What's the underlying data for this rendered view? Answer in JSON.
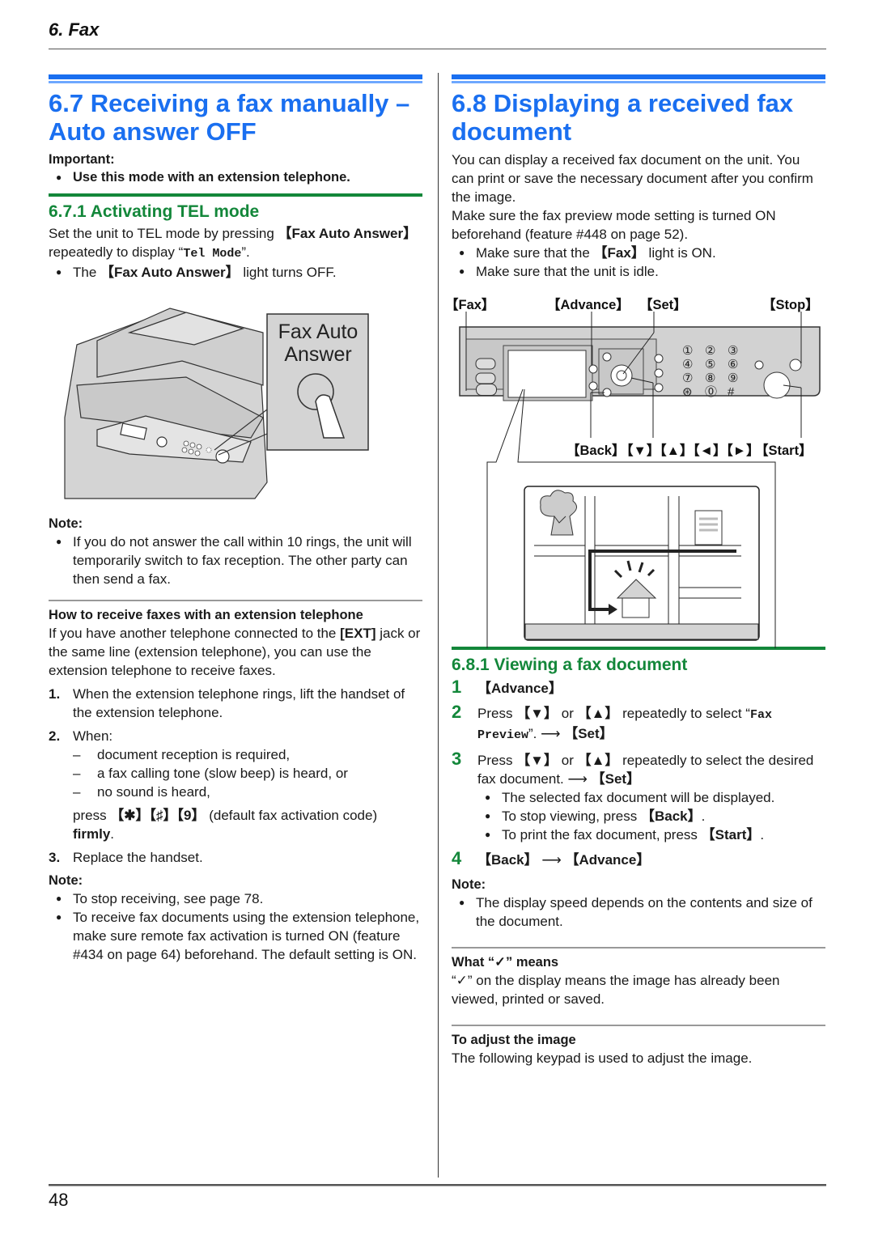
{
  "header": {
    "chapter": "6. Fax"
  },
  "footer": {
    "page_number": "48"
  },
  "left": {
    "title": "6.7 Receiving a fax manually – Auto answer OFF",
    "important_label": "Important:",
    "important_items": [
      "Use this mode with an extension telephone."
    ],
    "subsection_title": "6.7.1 Activating TEL mode",
    "intro": {
      "pre": "Set the unit to TEL mode by pressing ",
      "key": "【Fax Auto Answer】",
      "mid": " repeatedly to display “",
      "mono": "Tel Mode",
      "post": "”."
    },
    "intro_bullet": {
      "pre": "The ",
      "key": "【Fax Auto Answer】",
      "post": " light turns OFF."
    },
    "figure": {
      "button_label_line1": "Fax Auto",
      "button_label_line2": "Answer"
    },
    "note1_label": "Note:",
    "note1_items": [
      "If you do not answer the call within 10 rings, the unit will temporarily switch to fax reception. The other party can then send a fax."
    ],
    "how_to_title": "How to receive faxes with an extension telephone",
    "how_to_intro": {
      "pre": "If you have another telephone connected to the ",
      "key": "[EXT]",
      "post": " jack or the same line (extension telephone), you can use the extension telephone to receive faxes."
    },
    "steps": [
      {
        "num": "1.",
        "text": "When the extension telephone rings, lift the handset of the extension telephone."
      },
      {
        "num": "2.",
        "text": "When:"
      },
      {
        "num": "3.",
        "text": "Replace the handset."
      }
    ],
    "step2_conditions": [
      "document reception is required,",
      "a fax calling tone (slow beep) is heard, or",
      "no sound is heard,"
    ],
    "step2_press": {
      "pre": "press ",
      "keys": "【✱】【♯】【9】",
      "post": " (default fax activation code)",
      "firmly": "firmly",
      "end": "."
    },
    "note2_label": "Note:",
    "note2_items": [
      "To stop receiving, see page 78.",
      "To receive fax documents using the extension telephone, make sure remote fax activation is turned ON (feature #434 on page 64) beforehand. The default setting is ON."
    ]
  },
  "right": {
    "title": "6.8 Displaying a received fax document",
    "intro_lines": [
      "You can display a received fax document on the unit. You can print or save the necessary document after you confirm the image.",
      "Make sure the fax preview mode setting is turned ON beforehand (feature #448 on page 52)."
    ],
    "pre_bullets": [
      {
        "pre": "Make sure that the ",
        "key": "【Fax】",
        "post": " light is ON."
      },
      {
        "pre": "Make sure that the unit is idle.",
        "key": "",
        "post": ""
      }
    ],
    "panel_callouts": {
      "fax": "【Fax】",
      "advance": "【Advance】",
      "set": "【Set】",
      "stop": "【Stop】",
      "back": "【Back】",
      "arrows": "【▼】【▲】【◄】【►】",
      "start": "【Start】"
    },
    "keypad": [
      "①",
      "②",
      "③",
      "④",
      "⑤",
      "⑥",
      "⑦",
      "⑧",
      "⑨",
      "⊛",
      "⓪",
      "#"
    ],
    "subsection_title": "6.8.1 Viewing a fax document",
    "steps": [
      {
        "num": "1",
        "key": "【Advance】"
      },
      {
        "num": "2",
        "pre": "Press ",
        "k1": "【▼】",
        "or": " or ",
        "k2": "【▲】",
        "mid": " repeatedly to select “",
        "mono": "Fax Preview",
        "post": "”. ⟶ ",
        "end": "【Set】"
      },
      {
        "num": "3",
        "pre": "Press ",
        "k1": "【▼】",
        "or": " or ",
        "k2": "【▲】",
        "mid": " repeatedly to select the desired fax document. ⟶ ",
        "end": "【Set】"
      },
      {
        "num": "4",
        "k1": "【Back】",
        "arrow": " ⟶ ",
        "k2": "【Advance】"
      }
    ],
    "step3_bullets": [
      {
        "pre": "The selected fax document will be displayed.",
        "key": "",
        "post": ""
      },
      {
        "pre": "To stop viewing, press ",
        "key": "【Back】",
        "post": "."
      },
      {
        "pre": "To print the fax document, press ",
        "key": "【Start】",
        "post": "."
      }
    ],
    "note_label": "Note:",
    "note_items": [
      "The display speed depends on the contents and size of the document."
    ],
    "what_means_title": "What “✓” means",
    "what_means_text": "“✓” on the display means the image has already been viewed, printed or saved.",
    "adjust_title": "To adjust the image",
    "adjust_text": "The following keypad is used to adjust the image."
  },
  "colors": {
    "heading_blue": "#1a6ff0",
    "heading_green": "#13873a"
  }
}
